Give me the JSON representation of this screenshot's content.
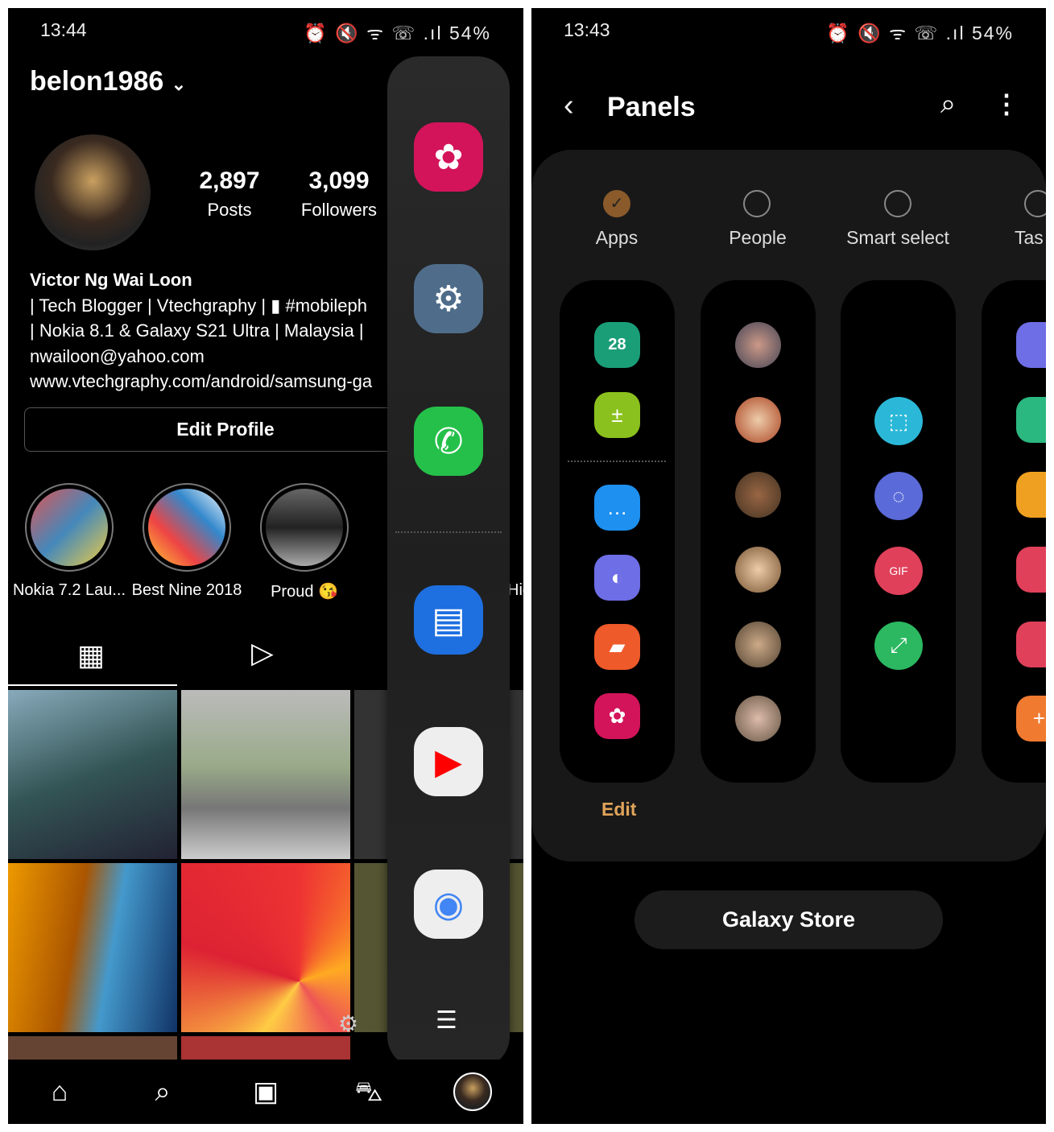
{
  "left": {
    "status": {
      "time": "13:44",
      "icons": "⏰ 🔇 ᯤ ☏ .ıl",
      "battery": "54%"
    },
    "profile": {
      "username": "belon1986",
      "posts_count": "2,897",
      "posts_label": "Posts",
      "followers_count": "3,099",
      "followers_label": "Followers",
      "name": "Victor Ng Wai Loon",
      "bio": [
        "| Tech Blogger | Vtechgraphy | ▮ #mobileph",
        "| Nokia 8.1 & Galaxy S21 Ultra | Malaysia |",
        "nwailoon@yahoo.com",
        "www.vtechgraphy.com/android/samsung-ga"
      ],
      "edit_profile": "Edit Profile"
    },
    "highlights": [
      {
        "label": "Nokia 7.2 Lau..."
      },
      {
        "label": "Best Nine 2018"
      },
      {
        "label": "Proud 😘"
      },
      {
        "label": "Hig"
      }
    ],
    "edge_panel_apps": [
      "Gallery",
      "Settings",
      "WhatsApp",
      "Messages",
      "YouTube",
      "Chrome"
    ],
    "nav": [
      "home-icon",
      "search-icon",
      "reels-icon",
      "shop-icon",
      "profile-avatar"
    ]
  },
  "right": {
    "status": {
      "time": "13:43",
      "icons": "⏰ 🔇 ᯤ ☏ .ıl",
      "battery": "54%"
    },
    "title": "Panels",
    "panels": [
      {
        "label": "Apps",
        "selected": true
      },
      {
        "label": "People",
        "selected": false
      },
      {
        "label": "Smart select",
        "selected": false
      },
      {
        "label": "Tas",
        "selected": false
      }
    ],
    "edit_label": "Edit",
    "galaxy_store": "Galaxy Store",
    "accent_color": "#8a5a2b",
    "calendar_day": "28"
  }
}
